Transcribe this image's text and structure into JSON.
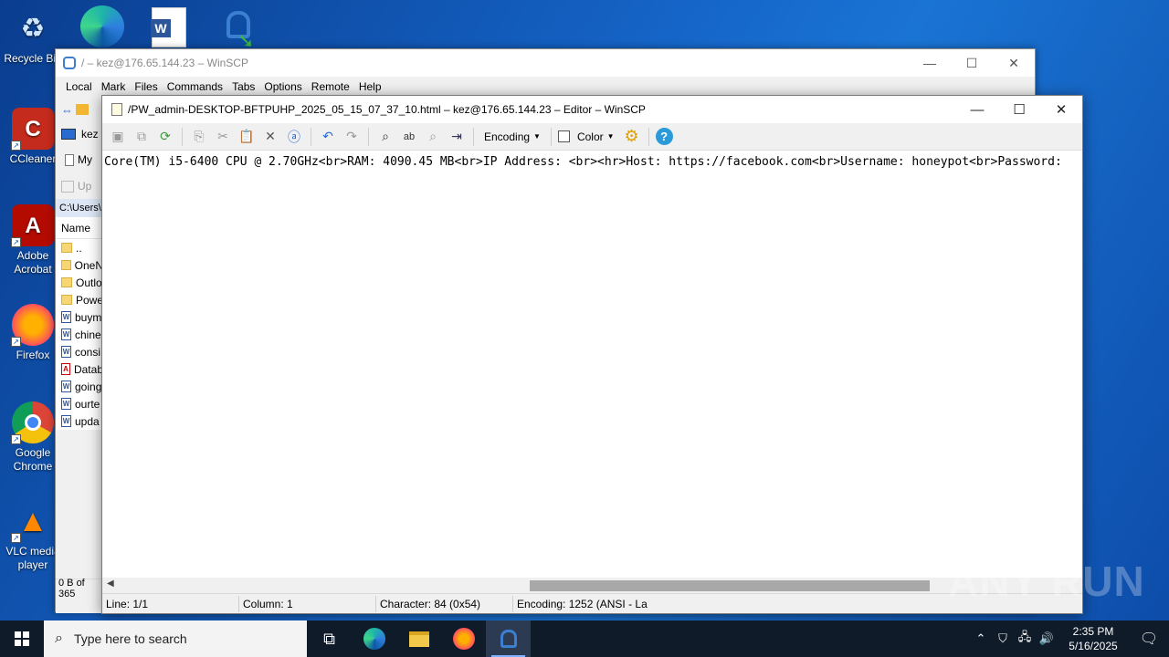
{
  "desktop": {
    "icons": [
      {
        "label": "Recycle Bin"
      },
      {
        "label": "CCleaner"
      },
      {
        "label": "Adobe Acrobat"
      },
      {
        "label": "Firefox"
      },
      {
        "label": "Google Chrome"
      },
      {
        "label": "VLC media player"
      }
    ]
  },
  "main_window": {
    "title": "/ – kez@176.65.144.23 – WinSCP",
    "menu": [
      "Local",
      "Mark",
      "Files",
      "Commands",
      "Tabs",
      "Options",
      "Remote",
      "Help"
    ],
    "left_panel": {
      "session": "kez",
      "my_docs": "My",
      "upload": "Up",
      "path": "C:\\Users\\",
      "column_name": "Name",
      "files": [
        "..",
        "OneN",
        "Outlo",
        "Powe",
        "buym",
        "chine",
        "consi",
        "Datab",
        "going",
        "ourte",
        "upda"
      ],
      "status": "0 B of 365"
    }
  },
  "editor": {
    "title": "/PW_admin-DESKTOP-BFTPUHP_2025_05_15_07_37_10.html – kez@176.65.144.23 – Editor – WinSCP",
    "toolbar": {
      "encoding_label": "Encoding",
      "color_label": "Color"
    },
    "content_line": "Core(TM) i5-6400 CPU @ 2.70GHz<br>RAM: 4090.45 MB<br>IP Address: <br><hr>Host: https://facebook.com<br>Username: honeypot<br>Password:",
    "status": {
      "line": "Line: 1/1",
      "column": "Column: 1",
      "character": "Character: 84 (0x54)",
      "encoding": "Encoding: 1252  (ANSI - La"
    }
  },
  "taskbar": {
    "search_placeholder": "Type here to search",
    "time": "2:35 PM",
    "date": "5/16/2025"
  },
  "watermark": "ANY RUN"
}
